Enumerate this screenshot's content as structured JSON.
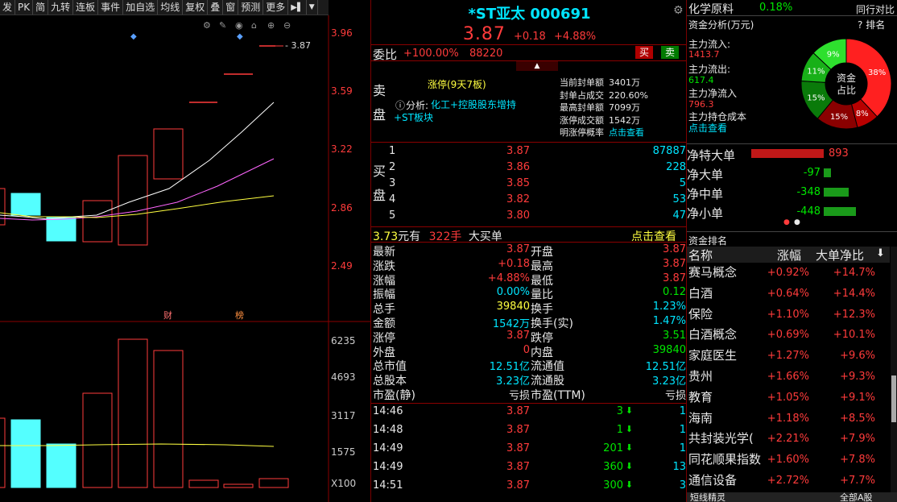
{
  "toolbar": [
    "发",
    "PK",
    "简",
    "九转",
    "连板",
    "事件",
    "加自选",
    "均线",
    "复权",
    "叠",
    "窗",
    "预测",
    "更多"
  ],
  "chart": {
    "price_ticks": [
      "3.96",
      "3.59",
      "3.22",
      "2.86",
      "2.49"
    ],
    "vol_ticks": [
      "6235",
      "4693",
      "3117",
      "1575",
      "X100"
    ],
    "last_label": "3.87",
    "marks": [
      "财",
      "榜"
    ]
  },
  "stock": {
    "name": "*ST亚太 000691",
    "price": "3.87",
    "change": "+0.18",
    "pct": "+4.88%"
  },
  "weibi": {
    "label": "委比",
    "value": "+100.00%",
    "amount": "88220",
    "buy": "买",
    "sell": "卖"
  },
  "seal": {
    "side": "卖盘",
    "tag": "涨停(9天7板)",
    "analysis_label": "分析:",
    "analysis": "化工+控股股东增持+ST板块",
    "info": [
      [
        "当前封单额",
        "3401万"
      ],
      [
        "封单占成交",
        "220.60%"
      ],
      [
        "最高封单额",
        "7099万"
      ],
      [
        "涨停成交额",
        "1542万"
      ],
      [
        "明涨停概率",
        "点击查看"
      ]
    ]
  },
  "bids": {
    "side": "买盘",
    "rows": [
      [
        "1",
        "3.87",
        "87887"
      ],
      [
        "2",
        "3.86",
        "228"
      ],
      [
        "3",
        "3.85",
        "5"
      ],
      [
        "4",
        "3.82",
        "53"
      ],
      [
        "5",
        "3.80",
        "47"
      ]
    ]
  },
  "bigorder": {
    "price": "3.73",
    "unit": "元有",
    "qty": "322手",
    "label": "大买单",
    "link": "点击查看"
  },
  "stats": [
    [
      "最新",
      "3.87",
      "开盘",
      "3.87"
    ],
    [
      "涨跌",
      "+0.18",
      "最高",
      "3.87"
    ],
    [
      "涨幅",
      "+4.88%",
      "最低",
      "3.87"
    ],
    [
      "振幅",
      "0.00%",
      "量比",
      "0.12"
    ],
    [
      "总手",
      "39840",
      "换手",
      "1.23%"
    ],
    [
      "金额",
      "1542万",
      "换手(实)",
      "1.47%"
    ],
    [
      "涨停",
      "3.87",
      "跌停",
      "3.51"
    ],
    [
      "外盘",
      "0",
      "内盘",
      "39840"
    ],
    [
      "总市值",
      "12.51亿",
      "流通值",
      "12.51亿"
    ],
    [
      "总股本",
      "3.23亿",
      "流通股",
      "3.23亿"
    ],
    [
      "市盈(静)",
      "亏损",
      "市盈(TTM)",
      "亏损"
    ]
  ],
  "ticks": [
    [
      "14:46",
      "3.87",
      "3",
      "1"
    ],
    [
      "14:48",
      "3.87",
      "1",
      "1"
    ],
    [
      "14:49",
      "3.87",
      "201",
      "1"
    ],
    [
      "14:49",
      "3.87",
      "360",
      "13"
    ],
    [
      "14:51",
      "3.87",
      "300",
      "3"
    ]
  ],
  "sector": {
    "name": "化学原料",
    "pct": "0.18%",
    "compare": "同行对比"
  },
  "fund": {
    "title": "资金分析(万元)",
    "rank": "排名",
    "inflow_label": "主力流入:",
    "inflow": "1413.7",
    "outflow_label": "主力流出:",
    "outflow": "617.4",
    "net_label": "主力净流入",
    "net": "796.3",
    "cost_label": "主力持仓成本",
    "cost_link": "点击查看",
    "donut_center": "资金占比",
    "slices": [
      38,
      8,
      15,
      15,
      11,
      9,
      4
    ]
  },
  "netflow": [
    [
      "净特大单",
      "893"
    ],
    [
      "净大单",
      "-97"
    ],
    [
      "净中单",
      "-348"
    ],
    [
      "净小单",
      "-448"
    ]
  ],
  "ranking": {
    "title": "资金排名",
    "cols": [
      "名称",
      "涨幅",
      "大单净比"
    ],
    "rows": [
      [
        "赛马概念",
        "+0.92%",
        "+14.7%"
      ],
      [
        "白酒",
        "+0.64%",
        "+14.4%"
      ],
      [
        "保险",
        "+1.10%",
        "+12.3%"
      ],
      [
        "白酒概念",
        "+0.69%",
        "+10.1%"
      ],
      [
        "家庭医生",
        "+1.27%",
        "+9.6%"
      ],
      [
        "贵州",
        "+1.66%",
        "+9.3%"
      ],
      [
        "教育",
        "+1.05%",
        "+9.1%"
      ],
      [
        "海南",
        "+1.18%",
        "+8.5%"
      ],
      [
        "共封装光学(",
        "+2.21%",
        "+7.9%"
      ],
      [
        "同花顺果指数",
        "+1.60%",
        "+7.8%"
      ],
      [
        "通信设备",
        "+2.72%",
        "+7.7%"
      ]
    ],
    "footer_left": "短线精灵",
    "footer_right": "全部A股"
  }
}
